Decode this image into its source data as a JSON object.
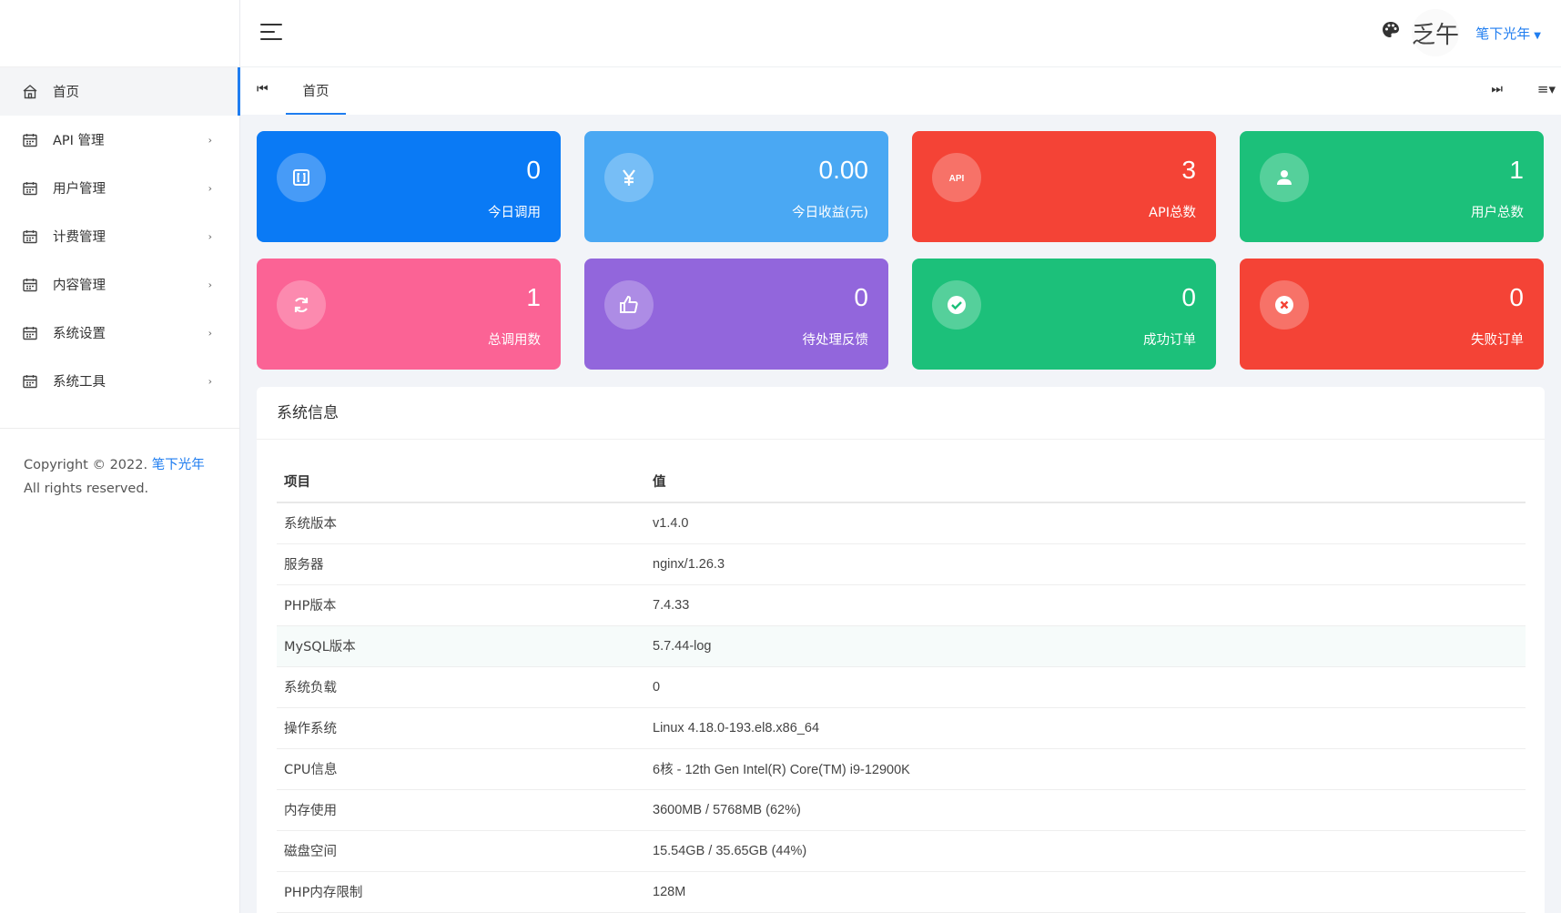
{
  "sidebar": {
    "items": [
      {
        "label": "首页",
        "active": true,
        "has_children": false
      },
      {
        "label": "API 管理",
        "active": false,
        "has_children": true
      },
      {
        "label": "用户管理",
        "active": false,
        "has_children": true
      },
      {
        "label": "计费管理",
        "active": false,
        "has_children": true
      },
      {
        "label": "内容管理",
        "active": false,
        "has_children": true
      },
      {
        "label": "系统设置",
        "active": false,
        "has_children": true
      },
      {
        "label": "系统工具",
        "active": false,
        "has_children": true
      }
    ],
    "copyright_prefix": "Copyright © 2022.",
    "copyright_brand": "笔下光年",
    "copyright_suffix": "All rights reserved."
  },
  "header": {
    "avatar_text": "乏午",
    "user_name": "笔下光年"
  },
  "tabs": {
    "home_label": "首页"
  },
  "cards": [
    {
      "value": "0",
      "label": "今日调用",
      "color": "#0a7af5",
      "icon": "bracket-icon"
    },
    {
      "value": "0.00",
      "label": "今日收益(元)",
      "color": "#4aa8f3",
      "icon": "yen-icon"
    },
    {
      "value": "3",
      "label": "API总数",
      "color": "#f44336",
      "icon": "api-icon"
    },
    {
      "value": "1",
      "label": "用户总数",
      "color": "#1cc07a",
      "icon": "user-icon"
    },
    {
      "value": "1",
      "label": "总调用数",
      "color": "#fb6395",
      "icon": "refresh-icon"
    },
    {
      "value": "0",
      "label": "待处理反馈",
      "color": "#9266dc",
      "icon": "thumbs-up-icon"
    },
    {
      "value": "0",
      "label": "成功订单",
      "color": "#1cc07a",
      "icon": "check-circle-icon"
    },
    {
      "value": "0",
      "label": "失败订单",
      "color": "#f44336",
      "icon": "close-circle-icon"
    }
  ],
  "system_info": {
    "title": "系统信息",
    "headers": [
      "项目",
      "值"
    ],
    "rows": [
      [
        "系统版本",
        "v1.4.0"
      ],
      [
        "服务器",
        "nginx/1.26.3"
      ],
      [
        "PHP版本",
        "7.4.33"
      ],
      [
        "MySQL版本",
        "5.7.44-log"
      ],
      [
        "系统负载",
        "0"
      ],
      [
        "操作系统",
        "Linux 4.18.0-193.el8.x86_64"
      ],
      [
        "CPU信息",
        "6核 - 12th Gen Intel(R) Core(TM) i9-12900K"
      ],
      [
        "内存使用",
        "3600MB / 5768MB (62%)"
      ],
      [
        "磁盘空间",
        "15.54GB / 35.65GB (44%)"
      ],
      [
        "PHP内存限制",
        "128M"
      ]
    ]
  }
}
